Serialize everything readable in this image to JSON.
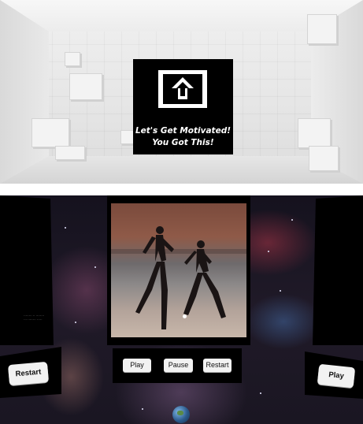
{
  "room": {
    "motivation_panel": {
      "line1": "Let's Get Motivated!",
      "line2": "You Got This!",
      "icon": "upload-arrow-icon"
    }
  },
  "space_scene": {
    "video_controls": {
      "play_label": "Play",
      "pause_label": "Pause",
      "restart_label": "Restart"
    },
    "left_panel": {
      "small_text_line1": "········ ·· ········",
      "small_text_line2": "··· ········ ·····",
      "restart_label": "Restart"
    },
    "right_panel": {
      "play_label": "Play"
    },
    "icons": {
      "globe": "globe-icon"
    },
    "colors": {
      "panel_bg": "#000000",
      "button_bg": "#f2f2f2"
    }
  }
}
